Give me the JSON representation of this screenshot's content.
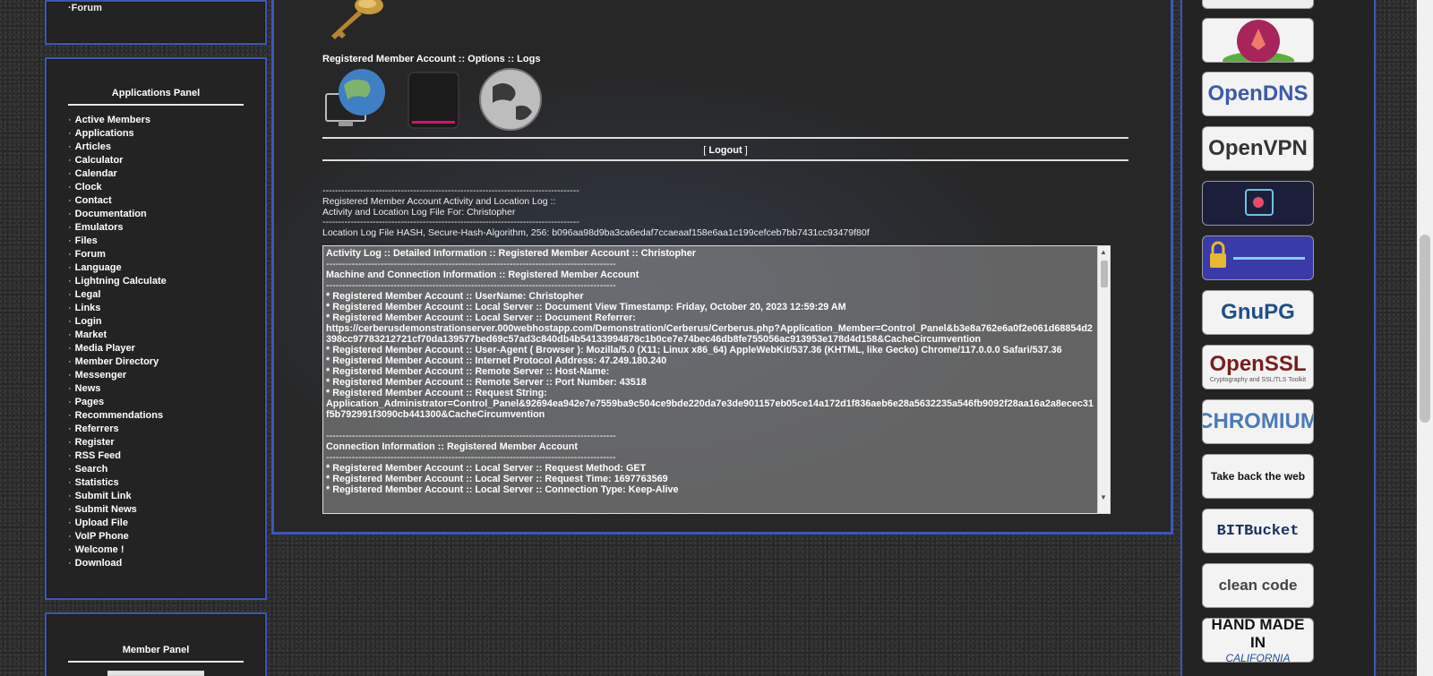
{
  "left": {
    "top_panel": {
      "items": [
        "Forum"
      ]
    },
    "applications_panel": {
      "title": "Applications Panel",
      "items": [
        "Active Members",
        "Applications",
        "Articles",
        "Calculator",
        "Calendar",
        "Clock",
        "Contact",
        "Documentation",
        "Emulators",
        "Files",
        "Forum",
        "Language",
        "Lightning Calculate",
        "Legal",
        "Links",
        "Login",
        "Market",
        "Media Player",
        "Member Directory",
        "Messenger",
        "News",
        "Pages",
        "Recommendations",
        "Referrers",
        "Register",
        "RSS Feed",
        "Search",
        "Statistics",
        "Submit Link",
        "Submit News",
        "Upload File",
        "VoIP Phone",
        "Welcome !",
        "Download"
      ]
    },
    "member_panel": {
      "title": "Member Panel"
    }
  },
  "center": {
    "account_links": "Registered Member Account :: Options :: Logs",
    "logout_label": "Logout",
    "log_info": {
      "dash": "----------------------------------------------------------------------------------",
      "title": "Registered Member Account Activity and Location Log ::",
      "file_for": "Activity and Location Log File For: Christopher",
      "hash": "Location Log File HASH, Secure-Hash-Algorithm, 256: b096aa98d9ba3ca6edaf7ccaeaaf158e6aa1c199cefceb7bb7431cc93479f80f"
    },
    "logbox": {
      "dash": "------------------------------------------------------------------------------------------",
      "heading": "Activity Log :: Detailed Information :: Registered Member Account :: Christopher",
      "machine_heading": "Machine and Connection Information :: Registered Member Account",
      "lines1": [
        "* Registered Member Account :: UserName: Christopher",
        "* Registered Member Account :: Local Server :: Document View Timestamp: Friday, October 20, 2023 12:59:29 AM",
        "* Registered Member Account :: Local Server :: Document Referrer:",
        "https://cerberusdemonstrationserver.000webhostapp.com/Demonstration/Cerberus/Cerberus.php?Application_Member=Control_Panel&b3e8a762e6a0f2e061d68854d2398cc97783212721cf70da139577bed69c57ad3c840db4b54133994878c1b0ce7e74bec46db8fe755056ac913953e178d4d158&CacheCircumvention",
        "* Registered Member Account :: User-Agent ( Browser ): Mozilla/5.0 (X11; Linux x86_64) AppleWebKit/537.36 (KHTML, like Gecko) Chrome/117.0.0.0 Safari/537.36",
        "* Registered Member Account :: Internet Protocol Address: 47.249.180.240",
        "* Registered Member Account :: Remote Server :: Host-Name:",
        "* Registered Member Account :: Remote Server :: Port Number: 43518",
        "* Registered Member Account :: Request String:",
        "Application_Administrator=Control_Panel&92694ea942e7e7559ba9c504ce9bde220da7e3de901157eb05ce14a172d1f836aeb6e28a5632235a546fb9092f28aa16a2a8ecec31f5b792991f3090cb441300&CacheCircumvention"
      ],
      "connection_heading": "Connection Information :: Registered Member Account",
      "lines2": [
        "* Registered Member Account :: Local Server :: Request Method: GET",
        "* Registered Member Account :: Local Server :: Request Time: 1697763569",
        "* Registered Member Account :: Local Server :: Connection Type: Keep-Alive"
      ]
    }
  },
  "right": {
    "badges": [
      {
        "name": "opendns",
        "text": "OpenDNS",
        "color": "#3b5ba9"
      },
      {
        "name": "openvpn",
        "text": "OpenVPN",
        "color": "#333333"
      },
      {
        "name": "gnupg",
        "text": "GnuPG",
        "color": "#1f4e8c"
      },
      {
        "name": "openssl",
        "text": "OpenSSL",
        "sub": "Cryptography and SSL/TLS Toolkit",
        "color": "#7a1d1d"
      },
      {
        "name": "chromium",
        "text": "CHROMIUM",
        "color": "#4a7ab8"
      },
      {
        "name": "firefox",
        "text": "Take back the web",
        "color": "#111111"
      },
      {
        "name": "bitbucket",
        "text": "BITBucket",
        "color": "#17315f"
      },
      {
        "name": "cleancode",
        "text": "clean code",
        "color": "#444444"
      },
      {
        "name": "handmade",
        "text": "HAND MADE IN",
        "sub": "CALIFORNIA",
        "color": "#111111"
      }
    ]
  }
}
